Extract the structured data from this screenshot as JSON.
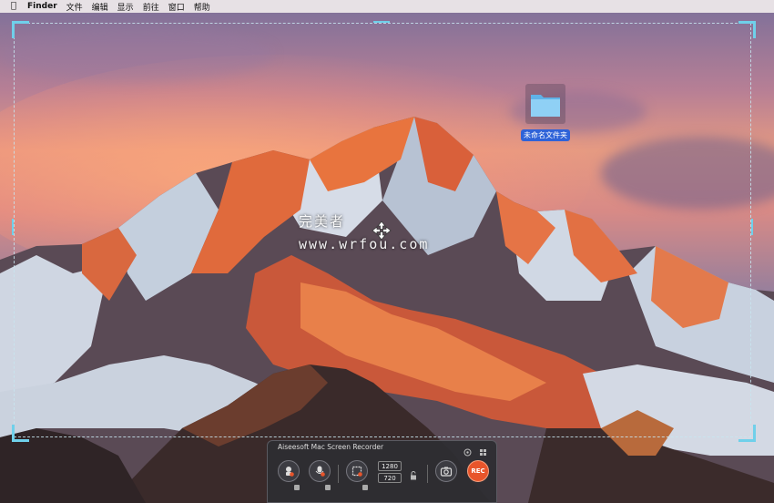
{
  "menubar": {
    "app_name": "Finder",
    "items": [
      "文件",
      "编辑",
      "显示",
      "前往",
      "窗口",
      "帮助"
    ]
  },
  "desktop": {
    "folder_label": "未命名文件夹"
  },
  "watermark": {
    "text": "完美者",
    "url": "www.wrfou.com"
  },
  "recorder": {
    "title": "Aiseesoft Mac Screen Recorder",
    "width": "1280",
    "height": "720",
    "rec_label": "REC",
    "accent_color": "#e8552b",
    "selection_color": "#6fd0ea"
  },
  "icons": [
    "apple-icon",
    "folder-icon",
    "move-arrows-icon",
    "settings-icon",
    "expand-icon",
    "webcam-icon",
    "microphone-icon",
    "region-icon",
    "lock-icon",
    "camera-icon"
  ]
}
